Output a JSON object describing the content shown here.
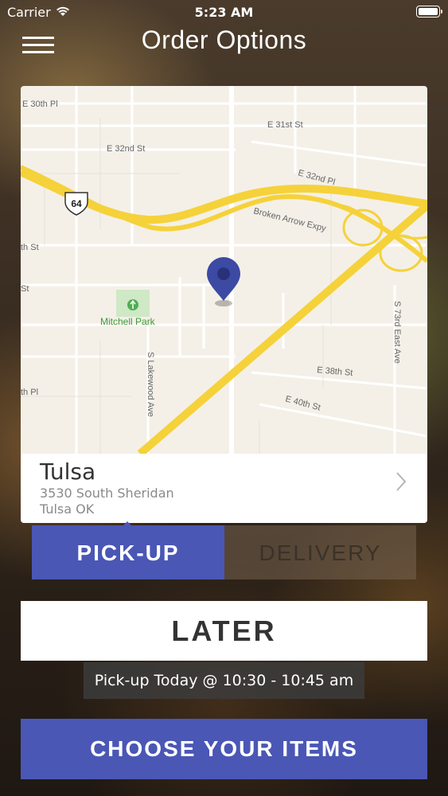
{
  "status_bar": {
    "carrier": "Carrier",
    "time": "5:23 AM"
  },
  "header": {
    "title": "Order Options"
  },
  "map": {
    "labels": {
      "e30": "E 30th Pl",
      "e31": "E 31st St",
      "e32st": "E 32nd St",
      "e32pl": "E 32nd Pl",
      "broken_arrow": "Broken Arrow Expy",
      "highway": "64",
      "mitchell_park": "Mitchell Park",
      "lakewood": "S Lakewood Ave",
      "e38": "E 38th St",
      "e40": "E 40th St",
      "s73": "S 73rd East Ave",
      "th_st": "th St",
      "st": "St",
      "th_pl": "th Pl"
    }
  },
  "location": {
    "city": "Tulsa",
    "address_line1": "3530 South Sheridan",
    "address_line2": "Tulsa OK"
  },
  "tabs": {
    "pickup": "PICK-UP",
    "delivery": "DELIVERY"
  },
  "later_button": "LATER",
  "pickup_time": "Pick-up Today @ 10:30 - 10:45 am",
  "choose_button": "CHOOSE YOUR ITEMS",
  "colors": {
    "accent": "#4a57b5",
    "pin": "#3c4aa3",
    "road_major": "#f5d23a"
  },
  "icons": {
    "menu": "hamburger-menu-icon",
    "chevron": "chevron-right-icon",
    "pin": "map-pin-icon"
  }
}
